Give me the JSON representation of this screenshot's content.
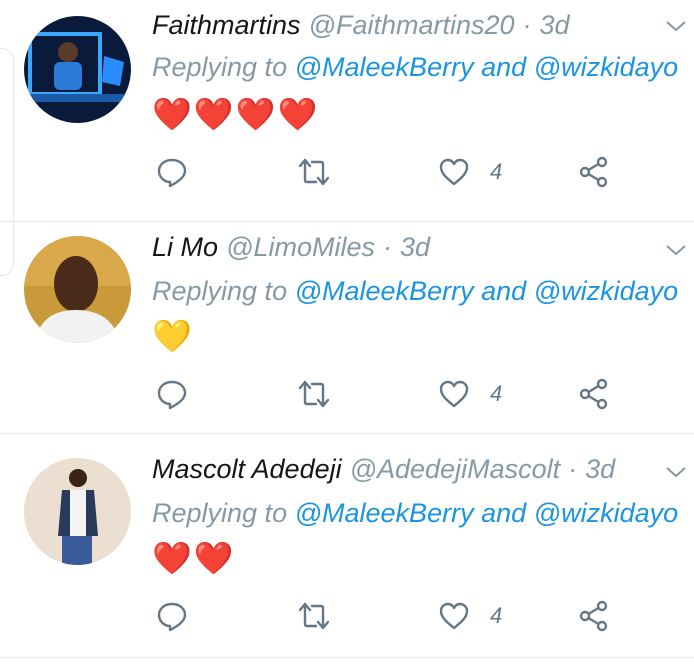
{
  "tweets": [
    {
      "name": "Faithmartins",
      "handle": "@Faithmartins20",
      "separator": "·",
      "time": "3d",
      "replying_prefix": "Replying to",
      "mention1": "@MaleekBerry",
      "and": "and",
      "mention2": "@wizkidayo",
      "emoji": "❤️❤️❤️❤️",
      "likes": "4"
    },
    {
      "name": "Li Mo",
      "handle": "@LimoMiles",
      "separator": "·",
      "time": "3d",
      "replying_prefix": "Replying to",
      "mention1": "@MaleekBerry",
      "and": "and",
      "mention2": "@wizkidayo",
      "emoji": "💛",
      "likes": "4"
    },
    {
      "name": "Mascolt Adedeji",
      "handle": "@AdedejiMascolt",
      "separator": "·",
      "time": "3d",
      "replying_prefix": "Replying to",
      "mention1": "@MaleekBerry",
      "and": "and",
      "mention2": "@wizkidayo",
      "emoji": "❤️❤️",
      "likes": "4"
    }
  ],
  "colors": {
    "accent": "#1b95e0",
    "muted": "#8899a6",
    "text": "#14171a",
    "icon": "#657786",
    "divider": "#e1e8ed"
  },
  "icons": [
    "reply-icon",
    "retweet-icon",
    "like-icon",
    "share-icon",
    "chevron-down-icon"
  ]
}
